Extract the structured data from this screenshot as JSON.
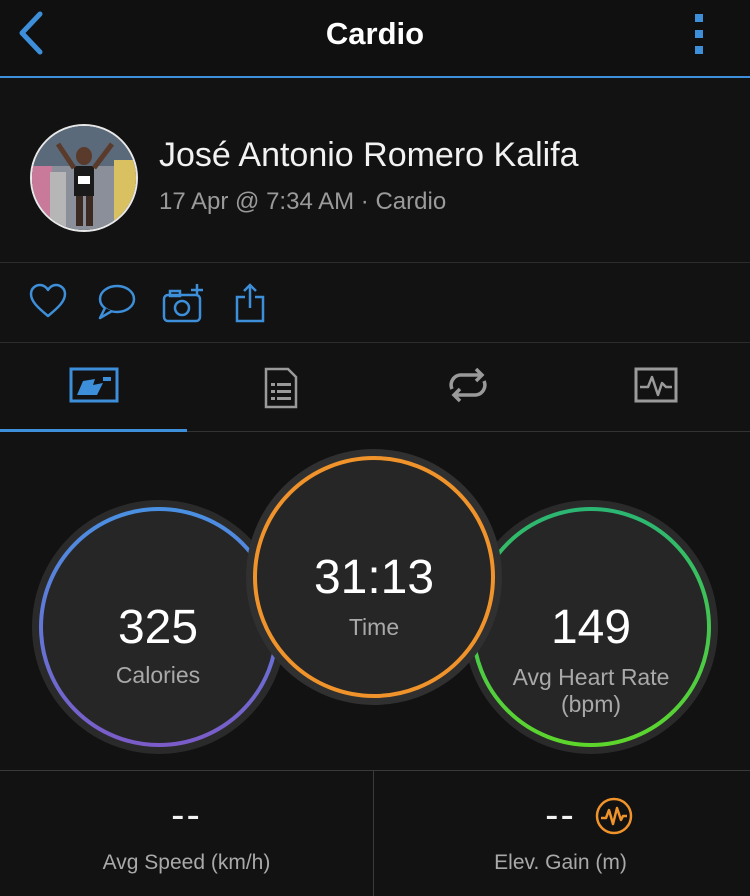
{
  "header": {
    "title": "Cardio",
    "back_icon": "chevron-left-icon",
    "more_icon": "more-vertical-icon",
    "accent_color": "#3d8fd9"
  },
  "profile": {
    "name": "José Antonio Romero Kalifa",
    "meta": "17 Apr @ 7:34 AM · Cardio"
  },
  "actions": [
    {
      "icon": "heart-icon"
    },
    {
      "icon": "comment-icon"
    },
    {
      "icon": "add-photo-icon"
    },
    {
      "icon": "share-icon"
    }
  ],
  "tabs": [
    {
      "icon": "overview-tab-icon",
      "active": true
    },
    {
      "icon": "details-list-tab-icon",
      "active": false
    },
    {
      "icon": "laps-tab-icon",
      "active": false
    },
    {
      "icon": "charts-tab-icon",
      "active": false
    }
  ],
  "stats": {
    "calories": {
      "value": "325",
      "label": "Calories",
      "colors": [
        "#4a90e2",
        "#7b5cc9"
      ]
    },
    "time": {
      "value": "31:13",
      "label": "Time",
      "color": "#f0932b"
    },
    "heart_rate": {
      "value": "149",
      "label_line1": "Avg Heart Rate",
      "label_line2": "(bpm)",
      "colors": [
        "#2bb673",
        "#5dd62c"
      ]
    }
  },
  "metrics": {
    "avg_speed": {
      "value": "--",
      "label": "Avg Speed (km/h)"
    },
    "elev_gain": {
      "value": "--",
      "label": "Elev. Gain (m)",
      "icon": "elevation-pulse-icon",
      "icon_color": "#f0932b"
    }
  }
}
